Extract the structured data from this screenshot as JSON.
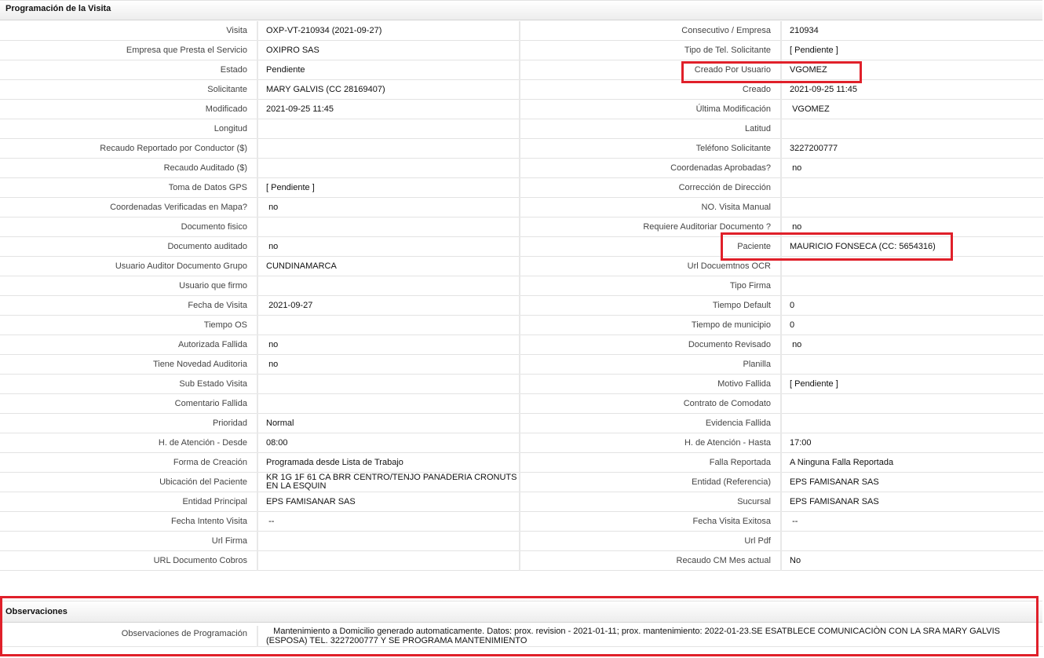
{
  "section_titles": {
    "programacion": "Programación de la Visita",
    "observaciones": "Observaciones"
  },
  "rows": [
    {
      "l1": "Visita",
      "v1": "OXP-VT-210934 (2021-09-27)",
      "l2": "Consecutivo / Empresa",
      "v2": "210934"
    },
    {
      "l1": "Empresa que Presta el Servicio",
      "v1": "OXIPRO SAS",
      "l2": "Tipo de Tel. Solicitante",
      "v2": "[ Pendiente ]"
    },
    {
      "l1": "Estado",
      "v1": "Pendiente",
      "l2": "Creado Por Usuario",
      "v2": "VGOMEZ"
    },
    {
      "l1": "Solicitante",
      "v1": "MARY GALVIS (CC 28169407)",
      "l2": "Creado",
      "v2": "2021-09-25 11:45"
    },
    {
      "l1": "Modificado",
      "v1": "2021-09-25 11:45",
      "l2": "Última Modificación",
      "v2": " VGOMEZ"
    },
    {
      "l1": "Longitud",
      "v1": "",
      "l2": "Latitud",
      "v2": ""
    },
    {
      "l1": "Recaudo Reportado por Conductor ($)",
      "v1": "",
      "l2": "Teléfono Solicitante",
      "v2": "3227200777"
    },
    {
      "l1": "Recaudo Auditado ($)",
      "v1": "",
      "l2": "Coordenadas Aprobadas?",
      "v2": " no"
    },
    {
      "l1": "Toma de Datos GPS",
      "v1": "[ Pendiente ]",
      "l2": "Corrección de Dirección",
      "v2": ""
    },
    {
      "l1": "Coordenadas Verificadas en Mapa?",
      "v1": " no",
      "l2": "NO. Visita Manual",
      "v2": ""
    },
    {
      "l1": "Documento fisico",
      "v1": "",
      "l2": "Requiere Auditoriar Documento ?",
      "v2": " no"
    },
    {
      "l1": "Documento auditado",
      "v1": " no",
      "l2": "Paciente",
      "v2": "MAURICIO FONSECA (CC: 5654316)"
    },
    {
      "l1": "Usuario Auditor Documento Grupo",
      "v1": "CUNDINAMARCA",
      "l2": "Url Docuemtnos OCR",
      "v2": ""
    },
    {
      "l1": "Usuario que firmo",
      "v1": "",
      "l2": "Tipo Firma",
      "v2": ""
    },
    {
      "l1": "Fecha de Visita",
      "v1": " 2021-09-27",
      "l2": "Tiempo Default",
      "v2": "0"
    },
    {
      "l1": "Tiempo OS",
      "v1": "",
      "l2": "Tiempo de municipio",
      "v2": "0"
    },
    {
      "l1": "Autorizada Fallida",
      "v1": " no",
      "l2": "Documento Revisado",
      "v2": " no"
    },
    {
      "l1": "Tiene Novedad Auditoria",
      "v1": " no",
      "l2": "Planilla",
      "v2": ""
    },
    {
      "l1": "Sub Estado Visita",
      "v1": "",
      "l2": "Motivo Fallida",
      "v2": "[ Pendiente ]"
    },
    {
      "l1": "Comentario Fallida",
      "v1": "",
      "l2": "Contrato de Comodato",
      "v2": ""
    },
    {
      "l1": "Prioridad",
      "v1": "Normal",
      "l2": "Evidencia Fallida",
      "v2": ""
    },
    {
      "l1": "H. de Atención - Desde",
      "v1": "08:00",
      "l2": "H. de Atención - Hasta",
      "v2": "17:00"
    },
    {
      "l1": "Forma de Creación",
      "v1": "Programada desde Lista de Trabajo",
      "l2": "Falla Reportada",
      "v2": "A Ninguna Falla Reportada"
    },
    {
      "l1": "Ubicación del Paciente",
      "v1": "KR 1G 1F 61 CA BRR CENTRO/TENJO PANADERIA CRONUTS EN LA ESQUIN",
      "l2": "Entidad (Referencia)",
      "v2": "EPS FAMISANAR SAS"
    },
    {
      "l1": "Entidad Principal",
      "v1": "EPS FAMISANAR SAS",
      "l2": "Sucursal",
      "v2": "EPS FAMISANAR SAS"
    },
    {
      "l1": "Fecha Intento Visita",
      "v1": " --",
      "l2": "Fecha Visita Exitosa",
      "v2": " --"
    },
    {
      "l1": "Url Firma",
      "v1": "",
      "l2": "Url Pdf",
      "v2": ""
    },
    {
      "l1": "URL Documento Cobros",
      "v1": "",
      "l2": "Recaudo CM Mes actual",
      "v2": "No"
    }
  ],
  "observaciones": {
    "label": "Observaciones de Programación",
    "value": "   Mantenimiento a Domicilio generado automaticamente. Datos: prox. revision - 2021-01-11; prox. mantenimiento: 2022-01-23.SE ESATBLECE COMUNICACIÒN CON LA SRA MARY GALVIS (ESPOSA) TEL. 3227200777 Y SE PROGRAMA MANTENIMIENTO"
  },
  "highlight_color": "#e0202a"
}
